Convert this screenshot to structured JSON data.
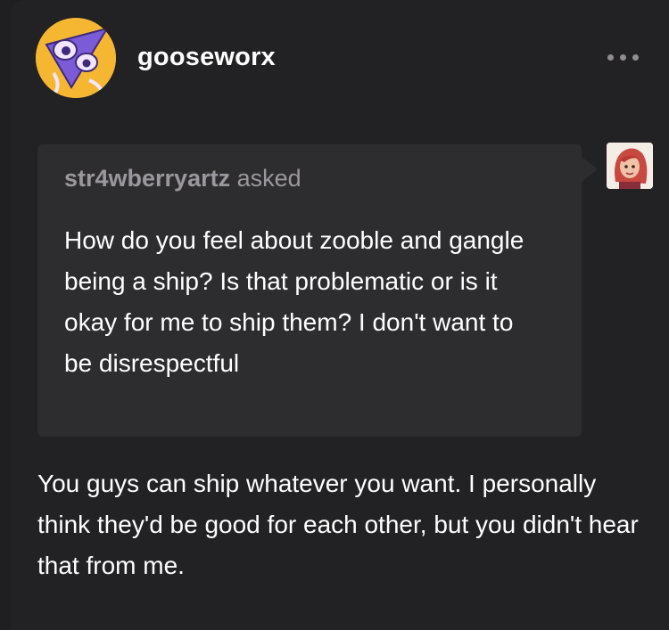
{
  "post": {
    "author": "gooseworx",
    "author_avatar_icon": "purple-triangle-eyes-avatar-icon",
    "menu_icon": "more-options-icon"
  },
  "ask": {
    "asker": "str4wberryartz",
    "asked_label": "asked",
    "asker_avatar_icon": "red-haired-character-avatar-icon",
    "question": "How do you feel about zooble and gangle being a ship? Is that problematic or is it okay for me to ship them? I don't want to be disrespectful"
  },
  "answer": {
    "text": "You guys can ship whatever you want. I personally think they'd be good for each other, but you didn't hear that from me."
  },
  "colors": {
    "background": "#222123",
    "ask_background": "#2d2c2f",
    "muted_text": "#9a989d",
    "avatar_yellow": "#f5b731",
    "avatar_purple": "#7b5bd6"
  }
}
